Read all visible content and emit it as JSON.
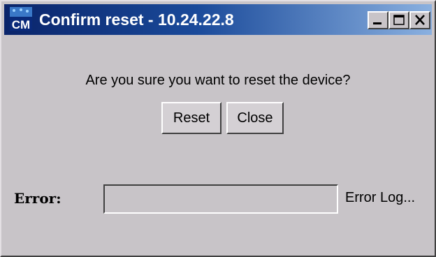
{
  "window": {
    "title": "Confirm reset - 10.24.22.8",
    "app_icon": "cm-app-icon",
    "controls": {
      "minimize_icon": "minimize-icon",
      "maximize_icon": "maximize-icon",
      "close_icon": "close-icon"
    }
  },
  "dialog": {
    "prompt": "Are you sure you want to reset the device?",
    "reset_label": "Reset",
    "close_label": "Close"
  },
  "error_row": {
    "label": "Error:",
    "value": "",
    "log_link": "Error Log..."
  },
  "colors": {
    "title_bar_start": "#0a246a",
    "title_bar_end": "#8ab0e0",
    "window_bg": "#c8c4c8"
  }
}
